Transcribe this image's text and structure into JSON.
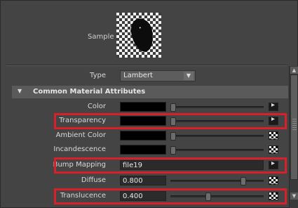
{
  "sample": {
    "label": "Sample"
  },
  "type": {
    "label": "Type",
    "value": "Lambert"
  },
  "section": {
    "title": "Common Material Attributes"
  },
  "attributes": [
    {
      "label": "Color",
      "kind": "color",
      "value": "",
      "swatch": "#000000",
      "slider": 0.0,
      "map": "linked"
    },
    {
      "label": "Transparency",
      "kind": "color",
      "value": "",
      "swatch": "#000000",
      "slider": 0.0,
      "map": "linked"
    },
    {
      "label": "Ambient Color",
      "kind": "color",
      "value": "",
      "swatch": "#000000",
      "slider": 0.0,
      "map": "checker"
    },
    {
      "label": "Incandescence",
      "kind": "color",
      "value": "",
      "swatch": "#000000",
      "slider": 0.0,
      "map": "checker"
    },
    {
      "label": "Bump Mapping",
      "kind": "file",
      "value": "file19",
      "map": "linked"
    },
    {
      "label": "Diffuse",
      "kind": "number",
      "value": "0.800",
      "slider": 0.8,
      "map": "checker"
    },
    {
      "label": "Translucence",
      "kind": "number",
      "value": "0.400",
      "slider": 0.4,
      "map": "checker"
    }
  ],
  "highlight_color": "#d8202c",
  "icons": {
    "section_toggle": "triangle-down-icon",
    "type_dropdown": "chevron-down-icon"
  }
}
